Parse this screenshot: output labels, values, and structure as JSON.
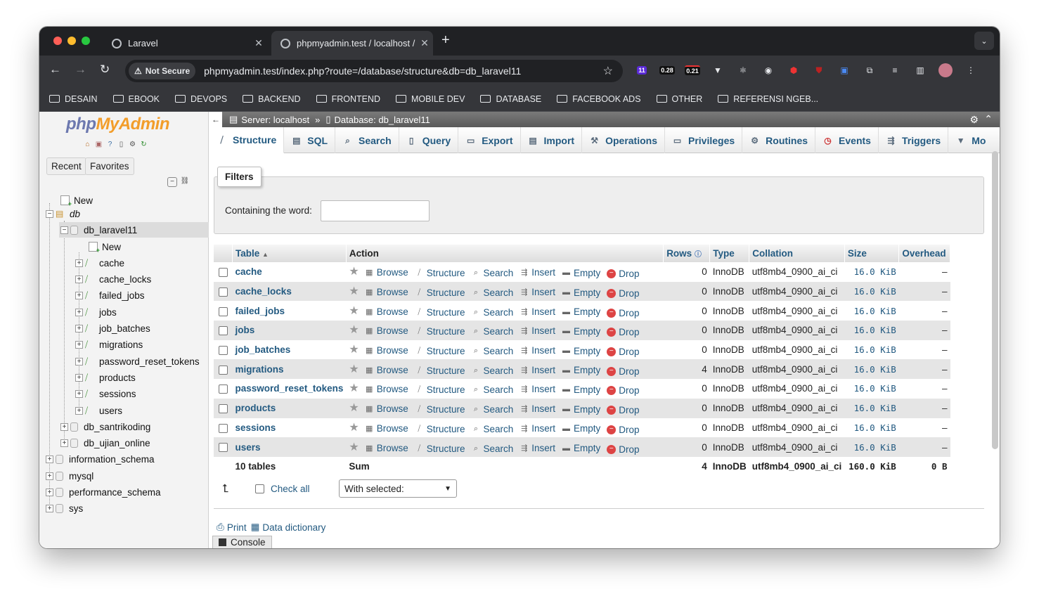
{
  "browser": {
    "tabs": [
      {
        "title": "Laravel",
        "active": false
      },
      {
        "title": "phpmyadmin.test / localhost / ",
        "active": true
      }
    ],
    "security_label": "Not Secure",
    "url": "phpmyadmin.test/index.php?route=/database/structure&db=db_laravel11",
    "extension_badges": [
      "11",
      "0.28",
      "0.21"
    ],
    "bookmarks": [
      "DESAIN",
      "EBOOK",
      "DEVOPS",
      "BACKEND",
      "FRONTEND",
      "MOBILE DEV",
      "DATABASE",
      "FACEBOOK ADS",
      "OTHER",
      "REFERENSI NGEB..."
    ]
  },
  "sidebar": {
    "logo_php": "php",
    "logo_myadmin": "MyAdmin",
    "recent_label": "Recent",
    "favorites_label": "Favorites",
    "tree": {
      "new_label": "New",
      "group_label": "db",
      "current_db": "db_laravel11",
      "db_new_label": "New",
      "tables": [
        "cache",
        "cache_locks",
        "failed_jobs",
        "jobs",
        "job_batches",
        "migrations",
        "password_reset_tokens",
        "products",
        "sessions",
        "users"
      ],
      "other_dbs": [
        "db_santrikoding",
        "db_ujian_online"
      ],
      "root_dbs": [
        "information_schema",
        "mysql",
        "performance_schema",
        "sys"
      ]
    }
  },
  "main": {
    "server_label": "Server: localhost",
    "database_label": "Database: db_laravel11",
    "tabs": [
      "Structure",
      "SQL",
      "Search",
      "Query",
      "Export",
      "Import",
      "Operations",
      "Privileges",
      "Routines",
      "Events",
      "Triggers",
      "Mo"
    ],
    "filters": {
      "legend": "Filters",
      "label": "Containing the word:"
    },
    "table": {
      "headers": [
        "Table",
        "Action",
        "Rows",
        "Type",
        "Collation",
        "Size",
        "Overhead"
      ],
      "actions": [
        "Browse",
        "Structure",
        "Search",
        "Insert",
        "Empty",
        "Drop"
      ],
      "rows": [
        {
          "name": "cache",
          "rows": "0",
          "type": "InnoDB",
          "collation": "utf8mb4_0900_ai_ci",
          "size": "16.0 KiB",
          "overhead": "–"
        },
        {
          "name": "cache_locks",
          "rows": "0",
          "type": "InnoDB",
          "collation": "utf8mb4_0900_ai_ci",
          "size": "16.0 KiB",
          "overhead": "–"
        },
        {
          "name": "failed_jobs",
          "rows": "0",
          "type": "InnoDB",
          "collation": "utf8mb4_0900_ai_ci",
          "size": "16.0 KiB",
          "overhead": "–"
        },
        {
          "name": "jobs",
          "rows": "0",
          "type": "InnoDB",
          "collation": "utf8mb4_0900_ai_ci",
          "size": "16.0 KiB",
          "overhead": "–"
        },
        {
          "name": "job_batches",
          "rows": "0",
          "type": "InnoDB",
          "collation": "utf8mb4_0900_ai_ci",
          "size": "16.0 KiB",
          "overhead": "–"
        },
        {
          "name": "migrations",
          "rows": "4",
          "type": "InnoDB",
          "collation": "utf8mb4_0900_ai_ci",
          "size": "16.0 KiB",
          "overhead": "–"
        },
        {
          "name": "password_reset_tokens",
          "rows": "0",
          "type": "InnoDB",
          "collation": "utf8mb4_0900_ai_ci",
          "size": "16.0 KiB",
          "overhead": "–"
        },
        {
          "name": "products",
          "rows": "0",
          "type": "InnoDB",
          "collation": "utf8mb4_0900_ai_ci",
          "size": "16.0 KiB",
          "overhead": "–"
        },
        {
          "name": "sessions",
          "rows": "0",
          "type": "InnoDB",
          "collation": "utf8mb4_0900_ai_ci",
          "size": "16.0 KiB",
          "overhead": "–"
        },
        {
          "name": "users",
          "rows": "0",
          "type": "InnoDB",
          "collation": "utf8mb4_0900_ai_ci",
          "size": "16.0 KiB",
          "overhead": "–"
        }
      ],
      "footer": {
        "tables": "10 tables",
        "sum": "Sum",
        "rows": "4",
        "type": "InnoDB",
        "collation": "utf8mb4_0900_ai_ci",
        "size": "160.0 KiB",
        "overhead": "0 B"
      }
    },
    "check_all_label": "Check all",
    "with_selected": "With selected:",
    "print_label": "Print",
    "data_dictionary_label": "Data dictionary",
    "console_label": "Console"
  },
  "colors": {
    "link": "#235a81",
    "logo_php": "#6c78af",
    "logo_myadmin": "#f29d2a",
    "chrome_dark": "#202124",
    "chrome_mid": "#35363a"
  }
}
